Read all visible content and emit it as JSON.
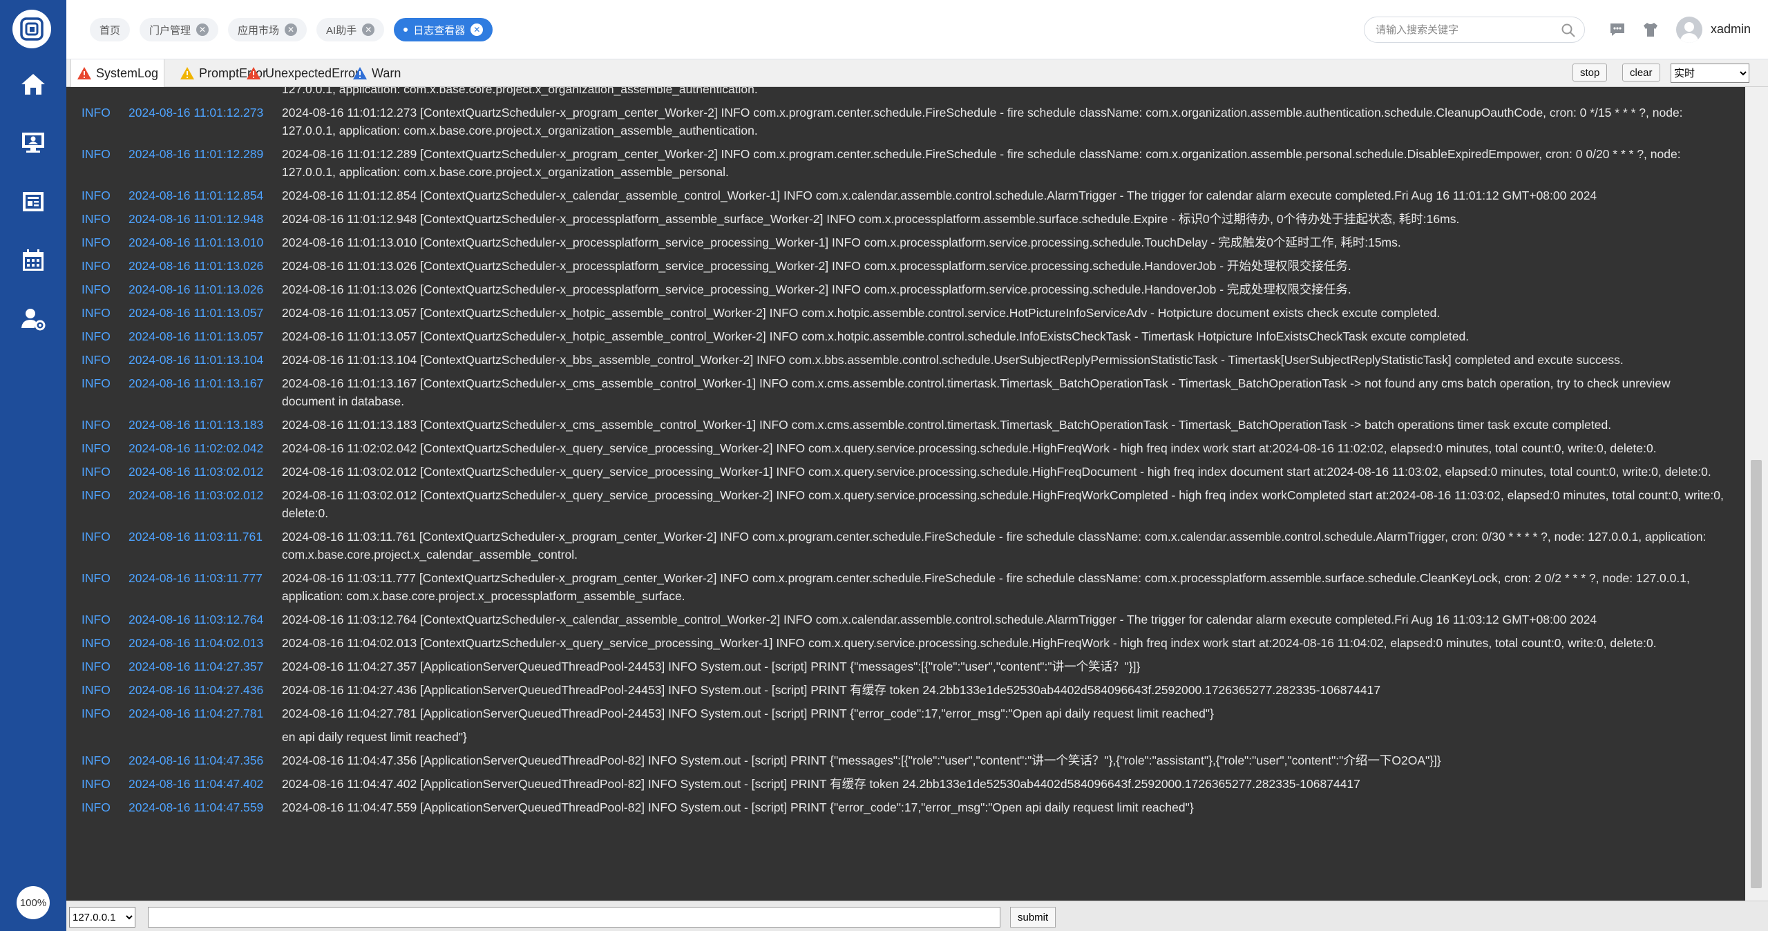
{
  "sidebar": {
    "zoom": "100%",
    "items": [
      {
        "name": "home"
      },
      {
        "name": "user-screen"
      },
      {
        "name": "news"
      },
      {
        "name": "calendar"
      },
      {
        "name": "user-settings"
      }
    ]
  },
  "tabs": [
    {
      "label": "首页",
      "closable": false,
      "active": false
    },
    {
      "label": "门户管理",
      "closable": true,
      "active": false
    },
    {
      "label": "应用市场",
      "closable": true,
      "active": false
    },
    {
      "label": "AI助手",
      "closable": true,
      "active": false
    },
    {
      "label": "日志查看器",
      "closable": true,
      "active": true
    }
  ],
  "search": {
    "placeholder": "请输入搜索关键字"
  },
  "user": {
    "name": "xadmin"
  },
  "logbar": {
    "tabs": [
      {
        "label": "SystemLog",
        "icon": "warning-red-icon"
      },
      {
        "label": "PromptError",
        "icon": "warning-yellow-icon"
      },
      {
        "label": "UnexpectedError",
        "icon": "warning-red-icon"
      },
      {
        "label": "Warn",
        "icon": "warning-blue-icon"
      }
    ],
    "stop_label": "stop",
    "clear_label": "clear",
    "mode_value": "实时"
  },
  "log_top_partial": "127.0.0.1, application: com.x.base.core.project.x_organization_assemble_authentication.",
  "logs": [
    {
      "level": "INFO",
      "time": "2024-08-16 11:01:12.273",
      "message": "2024-08-16 11:01:12.273 [ContextQuartzScheduler-x_program_center_Worker-2] INFO com.x.program.center.schedule.FireSchedule - fire schedule className: com.x.organization.assemble.authentication.schedule.CleanupOauthCode, cron: 0 */15 * * * ?, node: 127.0.0.1, application: com.x.base.core.project.x_organization_assemble_authentication."
    },
    {
      "level": "INFO",
      "time": "2024-08-16 11:01:12.289",
      "message": "2024-08-16 11:01:12.289 [ContextQuartzScheduler-x_program_center_Worker-2] INFO com.x.program.center.schedule.FireSchedule - fire schedule className: com.x.organization.assemble.personal.schedule.DisableExpiredEmpower, cron: 0 0/20 * * * ?, node: 127.0.0.1, application: com.x.base.core.project.x_organization_assemble_personal."
    },
    {
      "level": "INFO",
      "time": "2024-08-16 11:01:12.854",
      "message": "2024-08-16 11:01:12.854 [ContextQuartzScheduler-x_calendar_assemble_control_Worker-1] INFO com.x.calendar.assemble.control.schedule.AlarmTrigger - The trigger for calendar alarm execute completed.Fri Aug 16 11:01:12 GMT+08:00 2024"
    },
    {
      "level": "INFO",
      "time": "2024-08-16 11:01:12.948",
      "message": "2024-08-16 11:01:12.948 [ContextQuartzScheduler-x_processplatform_assemble_surface_Worker-2] INFO com.x.processplatform.assemble.surface.schedule.Expire - 标识0个过期待办, 0个待办处于挂起状态, 耗时:16ms."
    },
    {
      "level": "INFO",
      "time": "2024-08-16 11:01:13.010",
      "message": "2024-08-16 11:01:13.010 [ContextQuartzScheduler-x_processplatform_service_processing_Worker-1] INFO com.x.processplatform.service.processing.schedule.TouchDelay - 完成触发0个延时工作, 耗时:15ms."
    },
    {
      "level": "INFO",
      "time": "2024-08-16 11:01:13.026",
      "message": "2024-08-16 11:01:13.026 [ContextQuartzScheduler-x_processplatform_service_processing_Worker-2] INFO com.x.processplatform.service.processing.schedule.HandoverJob - 开始处理权限交接任务."
    },
    {
      "level": "INFO",
      "time": "2024-08-16 11:01:13.026",
      "message": "2024-08-16 11:01:13.026 [ContextQuartzScheduler-x_processplatform_service_processing_Worker-2] INFO com.x.processplatform.service.processing.schedule.HandoverJob - 完成处理权限交接任务."
    },
    {
      "level": "INFO",
      "time": "2024-08-16 11:01:13.057",
      "message": "2024-08-16 11:01:13.057 [ContextQuartzScheduler-x_hotpic_assemble_control_Worker-2] INFO com.x.hotpic.assemble.control.service.HotPictureInfoServiceAdv - Hotpicture document exists check excute completed."
    },
    {
      "level": "INFO",
      "time": "2024-08-16 11:01:13.057",
      "message": "2024-08-16 11:01:13.057 [ContextQuartzScheduler-x_hotpic_assemble_control_Worker-2] INFO com.x.hotpic.assemble.control.schedule.InfoExistsCheckTask - Timertask Hotpicture InfoExistsCheckTask excute completed."
    },
    {
      "level": "INFO",
      "time": "2024-08-16 11:01:13.104",
      "message": "2024-08-16 11:01:13.104 [ContextQuartzScheduler-x_bbs_assemble_control_Worker-2] INFO com.x.bbs.assemble.control.schedule.UserSubjectReplyPermissionStatisticTask - Timertask[UserSubjectReplyStatisticTask] completed and excute success."
    },
    {
      "level": "INFO",
      "time": "2024-08-16 11:01:13.167",
      "message": "2024-08-16 11:01:13.167 [ContextQuartzScheduler-x_cms_assemble_control_Worker-1] INFO com.x.cms.assemble.control.timertask.Timertask_BatchOperationTask - Timertask_BatchOperationTask -> not found any cms batch operation, try to check unreview document in database."
    },
    {
      "level": "INFO",
      "time": "2024-08-16 11:01:13.183",
      "message": "2024-08-16 11:01:13.183 [ContextQuartzScheduler-x_cms_assemble_control_Worker-1] INFO com.x.cms.assemble.control.timertask.Timertask_BatchOperationTask - Timertask_BatchOperationTask -> batch operations timer task excute completed."
    },
    {
      "level": "INFO",
      "time": "2024-08-16 11:02:02.042",
      "message": "2024-08-16 11:02:02.042 [ContextQuartzScheduler-x_query_service_processing_Worker-2] INFO com.x.query.service.processing.schedule.HighFreqWork - high freq index work start at:2024-08-16 11:02:02, elapsed:0 minutes, total count:0, write:0, delete:0."
    },
    {
      "level": "INFO",
      "time": "2024-08-16 11:03:02.012",
      "message": "2024-08-16 11:03:02.012 [ContextQuartzScheduler-x_query_service_processing_Worker-1] INFO com.x.query.service.processing.schedule.HighFreqDocument - high freq index document start at:2024-08-16 11:03:02, elapsed:0 minutes, total count:0, write:0, delete:0."
    },
    {
      "level": "INFO",
      "time": "2024-08-16 11:03:02.012",
      "message": "2024-08-16 11:03:02.012 [ContextQuartzScheduler-x_query_service_processing_Worker-2] INFO com.x.query.service.processing.schedule.HighFreqWorkCompleted - high freq index workCompleted start at:2024-08-16 11:03:02, elapsed:0 minutes, total count:0, write:0, delete:0."
    },
    {
      "level": "INFO",
      "time": "2024-08-16 11:03:11.761",
      "message": "2024-08-16 11:03:11.761 [ContextQuartzScheduler-x_program_center_Worker-2] INFO com.x.program.center.schedule.FireSchedule - fire schedule className: com.x.calendar.assemble.control.schedule.AlarmTrigger, cron: 0/30 * * * * ?, node: 127.0.0.1, application: com.x.base.core.project.x_calendar_assemble_control."
    },
    {
      "level": "INFO",
      "time": "2024-08-16 11:03:11.777",
      "message": "2024-08-16 11:03:11.777 [ContextQuartzScheduler-x_program_center_Worker-2] INFO com.x.program.center.schedule.FireSchedule - fire schedule className: com.x.processplatform.assemble.surface.schedule.CleanKeyLock, cron: 2 0/2 * * * ?, node: 127.0.0.1, application: com.x.base.core.project.x_processplatform_assemble_surface."
    },
    {
      "level": "INFO",
      "time": "2024-08-16 11:03:12.764",
      "message": "2024-08-16 11:03:12.764 [ContextQuartzScheduler-x_calendar_assemble_control_Worker-2] INFO com.x.calendar.assemble.control.schedule.AlarmTrigger - The trigger for calendar alarm execute completed.Fri Aug 16 11:03:12 GMT+08:00 2024"
    },
    {
      "level": "INFO",
      "time": "2024-08-16 11:04:02.013",
      "message": "2024-08-16 11:04:02.013 [ContextQuartzScheduler-x_query_service_processing_Worker-1] INFO com.x.query.service.processing.schedule.HighFreqWork - high freq index work start at:2024-08-16 11:04:02, elapsed:0 minutes, total count:0, write:0, delete:0."
    },
    {
      "level": "INFO",
      "time": "2024-08-16 11:04:27.357",
      "message": "2024-08-16 11:04:27.357 [ApplicationServerQueuedThreadPool-24453] INFO System.out - [script] PRINT {\"messages\":[{\"role\":\"user\",\"content\":\"讲一个笑话？\"}]}"
    },
    {
      "level": "INFO",
      "time": "2024-08-16 11:04:27.436",
      "message": "2024-08-16 11:04:27.436 [ApplicationServerQueuedThreadPool-24453] INFO System.out - [script] PRINT 有缓存 token 24.2bb133e1de52530ab4402d584096643f.2592000.1726365277.282335-106874417"
    },
    {
      "level": "INFO",
      "time": "2024-08-16 11:04:27.781",
      "message": "2024-08-16 11:04:27.781 [ApplicationServerQueuedThreadPool-24453] INFO System.out - [script] PRINT {\"error_code\":17,\"error_msg\":\"Open api daily request limit reached\"}"
    },
    {
      "level": "",
      "time": "",
      "message": "en api daily request limit reached\"}"
    },
    {
      "level": "INFO",
      "time": "2024-08-16 11:04:47.356",
      "message": "2024-08-16 11:04:47.356 [ApplicationServerQueuedThreadPool-82] INFO System.out - [script] PRINT {\"messages\":[{\"role\":\"user\",\"content\":\"讲一个笑话？\"},{\"role\":\"assistant\"},{\"role\":\"user\",\"content\":\"介绍一下O2OA\"}]}"
    },
    {
      "level": "INFO",
      "time": "2024-08-16 11:04:47.402",
      "message": "2024-08-16 11:04:47.402 [ApplicationServerQueuedThreadPool-82] INFO System.out - [script] PRINT 有缓存 token 24.2bb133e1de52530ab4402d584096643f.2592000.1726365277.282335-106874417"
    },
    {
      "level": "INFO",
      "time": "2024-08-16 11:04:47.559",
      "message": "2024-08-16 11:04:47.559 [ApplicationServerQueuedThreadPool-82] INFO System.out - [script] PRINT {\"error_code\":17,\"error_msg\":\"Open api daily request limit reached\"}"
    }
  ],
  "bottom": {
    "host_value": "127.0.0.1",
    "submit_label": "submit"
  }
}
